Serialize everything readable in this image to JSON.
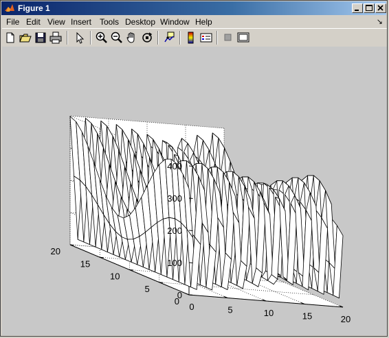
{
  "window": {
    "title": "Figure 1"
  },
  "menu": [
    {
      "id": "file",
      "label": "File"
    },
    {
      "id": "edit",
      "label": "Edit"
    },
    {
      "id": "view",
      "label": "View"
    },
    {
      "id": "insert",
      "label": "Insert"
    },
    {
      "id": "tools",
      "label": "Tools"
    },
    {
      "id": "desktop",
      "label": "Desktop"
    },
    {
      "id": "window",
      "label": "Window"
    },
    {
      "id": "help",
      "label": "Help"
    }
  ],
  "toolbar": [
    "new-figure-icon",
    "open-file-icon",
    "save-icon",
    "print-icon",
    "select-arrow-icon",
    "zoom-in-icon",
    "zoom-out-icon",
    "pan-hand-icon",
    "rotate-3d-icon",
    "data-cursor-icon",
    "colorbar-icon",
    "legend-icon",
    "hide-plot-tools-icon",
    "show-plot-tools-icon"
  ],
  "chart_data": {
    "type": "surface-mesh-3d",
    "z_ticks": [
      "0",
      "100",
      "200",
      "300",
      "400"
    ],
    "x_ticks": [
      "0",
      "5",
      "10",
      "15",
      "20"
    ],
    "y_ticks": [
      "0",
      "5",
      "10",
      "15",
      "20"
    ],
    "xlim": [
      0,
      20
    ],
    "ylim": [
      0,
      20
    ],
    "zlim": [
      0,
      400
    ],
    "grid": true,
    "colors": {
      "background": "#c8c8c8",
      "axes_face": "#ffffff",
      "mesh": "#000000"
    }
  }
}
